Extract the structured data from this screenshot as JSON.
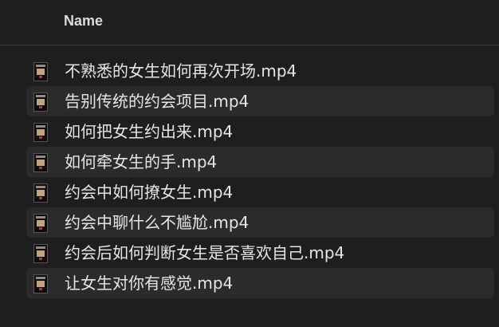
{
  "header": {
    "name_label": "Name"
  },
  "files": [
    {
      "name": "不熟悉的女生如何再次开场.mp4",
      "icon": "video-thumbnail-icon"
    },
    {
      "name": "告别传统的约会项目.mp4",
      "icon": "video-thumbnail-icon"
    },
    {
      "name": "如何把女生约出来.mp4",
      "icon": "video-thumbnail-icon"
    },
    {
      "name": "如何牵女生的手.mp4",
      "icon": "video-thumbnail-icon"
    },
    {
      "name": "约会中如何撩女生.mp4",
      "icon": "video-thumbnail-icon"
    },
    {
      "name": "约会中聊什么不尴尬.mp4",
      "icon": "video-thumbnail-icon"
    },
    {
      "name": "约会后如何判断女生是否喜欢自己.mp4",
      "icon": "video-thumbnail-icon"
    },
    {
      "name": "让女生对你有感觉.mp4",
      "icon": "video-thumbnail-icon"
    }
  ],
  "colors": {
    "background": "#1e1e1e",
    "alternate_row": "#2b2b2b",
    "text": "#e6e6e6",
    "header_text": "#dcdcdc"
  }
}
